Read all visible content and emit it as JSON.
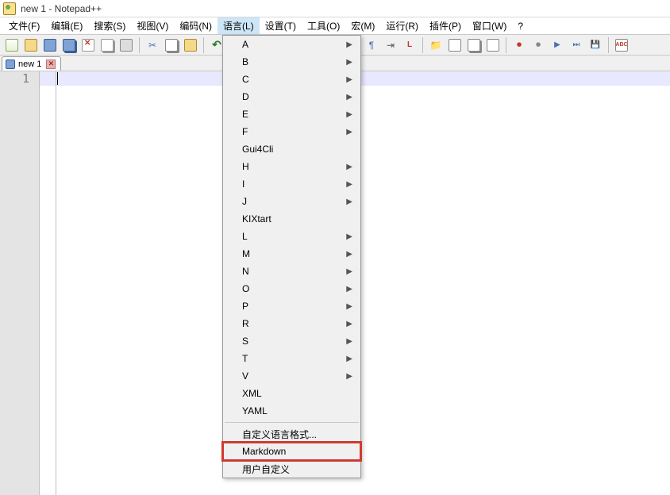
{
  "window": {
    "title": "new 1 - Notepad++"
  },
  "menubar": {
    "items": [
      {
        "label": "文件(F)"
      },
      {
        "label": "编辑(E)"
      },
      {
        "label": "搜索(S)"
      },
      {
        "label": "视图(V)"
      },
      {
        "label": "编码(N)"
      },
      {
        "label": "语言(L)",
        "selected": true
      },
      {
        "label": "设置(T)"
      },
      {
        "label": "工具(O)"
      },
      {
        "label": "宏(M)"
      },
      {
        "label": "运行(R)"
      },
      {
        "label": "插件(P)"
      },
      {
        "label": "窗口(W)"
      },
      {
        "label": "?"
      }
    ]
  },
  "tab": {
    "label": "new 1",
    "close": "✕"
  },
  "gutter": {
    "line1": "1"
  },
  "dropdown": {
    "items": [
      {
        "label": "A",
        "submenu": true
      },
      {
        "label": "B",
        "submenu": true
      },
      {
        "label": "C",
        "submenu": true
      },
      {
        "label": "D",
        "submenu": true
      },
      {
        "label": "E",
        "submenu": true
      },
      {
        "label": "F",
        "submenu": true
      },
      {
        "label": "Gui4Cli",
        "submenu": false
      },
      {
        "label": "H",
        "submenu": true
      },
      {
        "label": "I",
        "submenu": true
      },
      {
        "label": "J",
        "submenu": true
      },
      {
        "label": "KIXtart",
        "submenu": false
      },
      {
        "label": "L",
        "submenu": true
      },
      {
        "label": "M",
        "submenu": true
      },
      {
        "label": "N",
        "submenu": true
      },
      {
        "label": "O",
        "submenu": true
      },
      {
        "label": "P",
        "submenu": true
      },
      {
        "label": "R",
        "submenu": true
      },
      {
        "label": "S",
        "submenu": true
      },
      {
        "label": "T",
        "submenu": true
      },
      {
        "label": "V",
        "submenu": true
      },
      {
        "label": "XML",
        "submenu": false
      },
      {
        "label": "YAML",
        "submenu": false
      }
    ],
    "footer": [
      {
        "label": "自定义语言格式..."
      },
      {
        "label": "Markdown",
        "highlight": true
      },
      {
        "label": "用户自定义"
      }
    ]
  },
  "arrow_glyph": "▶"
}
